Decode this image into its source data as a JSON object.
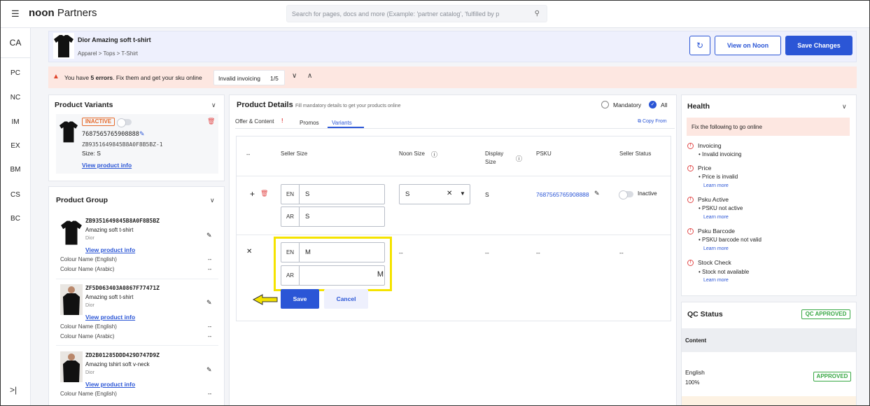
{
  "topbar": {
    "menu_icon": "hamburger-icon",
    "brand_bold": "noon",
    "brand_rest": " Partners",
    "search_placeholder": "Search for pages, docs and more (Example: 'partner catalog', 'fulfilled by p",
    "search_icon": "search-icon"
  },
  "sidebar": {
    "items": [
      "CA",
      "PC",
      "NC",
      "IM",
      "EX",
      "BM",
      "CS",
      "BC"
    ],
    "collapse_icon": ">|"
  },
  "header": {
    "product_title": "Dior Amazing soft t-shirt",
    "breadcrumb": "Apparel > Tops > T-Shirt",
    "history_icon": "history-icon",
    "view_label": "View on Noon",
    "save_label": "Save Changes"
  },
  "errors": {
    "prefix": "You have ",
    "count": "5 errors",
    "suffix": ". Fix them and get your sku online",
    "current_error": "Invalid invoicing",
    "position": "1/5"
  },
  "product_variants": {
    "title": "Product Variants",
    "status": "INACTIVE",
    "barcode": "7687565765908888",
    "psku": "ZB9351649845B8A0F8B5BZ-1",
    "size_label": "Size:",
    "size_value": "S",
    "link": "View product info"
  },
  "product_group": {
    "title": "Product Group",
    "items": [
      {
        "sku": "ZB9351649845B8A0F8B5BZ",
        "name": "Amazing soft t-shirt",
        "brand": "Dior",
        "link": "View product info",
        "colour_en": "Colour Name (English)",
        "colour_ar": "Colour Name (Arabic)",
        "dash": "--"
      },
      {
        "sku": "ZF5D063403A0867F77471Z",
        "name": "Amazing soft t-shirt",
        "brand": "Dior",
        "link": "View product info",
        "colour_en": "Colour Name (English)",
        "colour_ar": "Colour Name (Arabic)",
        "dash": "--"
      },
      {
        "sku": "ZD2B01285DDD429D747D9Z",
        "name": "Amazing tshirt soft v-neck",
        "brand": "Dior",
        "link": "View product info",
        "colour_en": "Colour Name (English)",
        "dash": "--"
      }
    ]
  },
  "product_details": {
    "title": "Product Details",
    "subtitle": "Fill mandatory details to get your products online",
    "filter_mandatory": "Mandatory",
    "filter_all": "All",
    "tabs": [
      "Offer & Content",
      "Promos",
      "Variants"
    ],
    "tab_alert": "!",
    "copy_from": "Copy From",
    "table": {
      "col_empty": "--",
      "col_seller_size": "Seller Size",
      "col_noon_size": "Noon Size",
      "col_display_size_1": "Display",
      "col_display_size_2": "Size",
      "col_psku": "PSKU",
      "col_seller_status": "Seller Status",
      "row1": {
        "en_label": "EN",
        "en_value": "S",
        "ar_label": "AR",
        "ar_value": "S",
        "noon_size": "S",
        "display_size": "S",
        "psku": "7687565765908888",
        "status": "Inactive"
      },
      "row2": {
        "en_label": "EN",
        "en_value": "M",
        "ar_label": "AR",
        "ar_value": "M",
        "noon_size": "--",
        "display_size": "--",
        "psku": "--",
        "status": "--"
      },
      "save_label": "Save",
      "cancel_label": "Cancel"
    }
  },
  "health": {
    "title": "Health",
    "fix_text": "Fix the following to go online",
    "learn_more": "Learn more",
    "items": [
      {
        "title": "Invoicing",
        "detail": "Invalid invoicing"
      },
      {
        "title": "Price",
        "detail": "Price is invalid"
      },
      {
        "title": "Psku Active",
        "detail": "PSKU not active"
      },
      {
        "title": "Psku Barcode",
        "detail": "PSKU barcode not valid"
      },
      {
        "title": "Stock Check",
        "detail": "Stock not available"
      }
    ]
  },
  "qc": {
    "title": "QC Status",
    "badge": "QC APPROVED",
    "content_label": "Content",
    "lang": "English",
    "percent": "100%",
    "lang_badge": "APPROVED"
  },
  "colors": {
    "accent": "#2b56d6",
    "error": "#e24b4b",
    "success": "#39a845",
    "highlight": "#f5e300"
  }
}
